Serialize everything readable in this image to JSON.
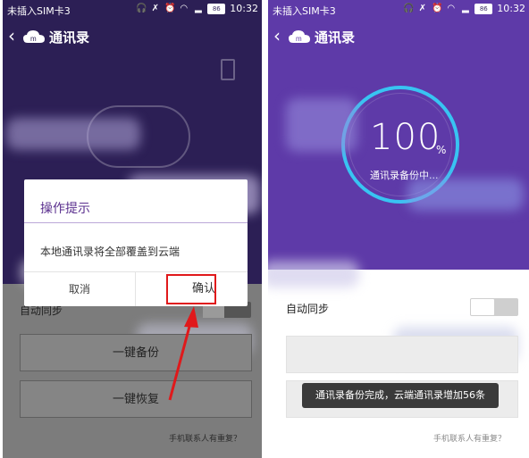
{
  "status_bar": {
    "carrier": "未插入SIM卡3",
    "battery": "86",
    "time": "10:32"
  },
  "app": {
    "title": "通讯录"
  },
  "left": {
    "dialog": {
      "title": "操作提示",
      "message": "本地通讯录将全部覆盖到云端",
      "cancel": "取消",
      "confirm": "确认"
    },
    "auto_sync_label": "自动同步",
    "backup_label": "一键备份",
    "restore_label": "一键恢复",
    "duplicate_link": "手机联系人有重复？"
  },
  "right": {
    "progress": {
      "value": "100",
      "unit": "%",
      "label": "通讯录备份中..."
    },
    "auto_sync_label": "自动同步",
    "toast": "通讯录备份完成，云端通讯录增加56条",
    "duplicate_link": "手机联系人有重复？"
  },
  "colors": {
    "left_header": "#2c1f55",
    "right_header": "#5e3aa8",
    "ring": "#38c4f2",
    "highlight": "#e0191b",
    "dialog_title": "#5a2f8e"
  }
}
